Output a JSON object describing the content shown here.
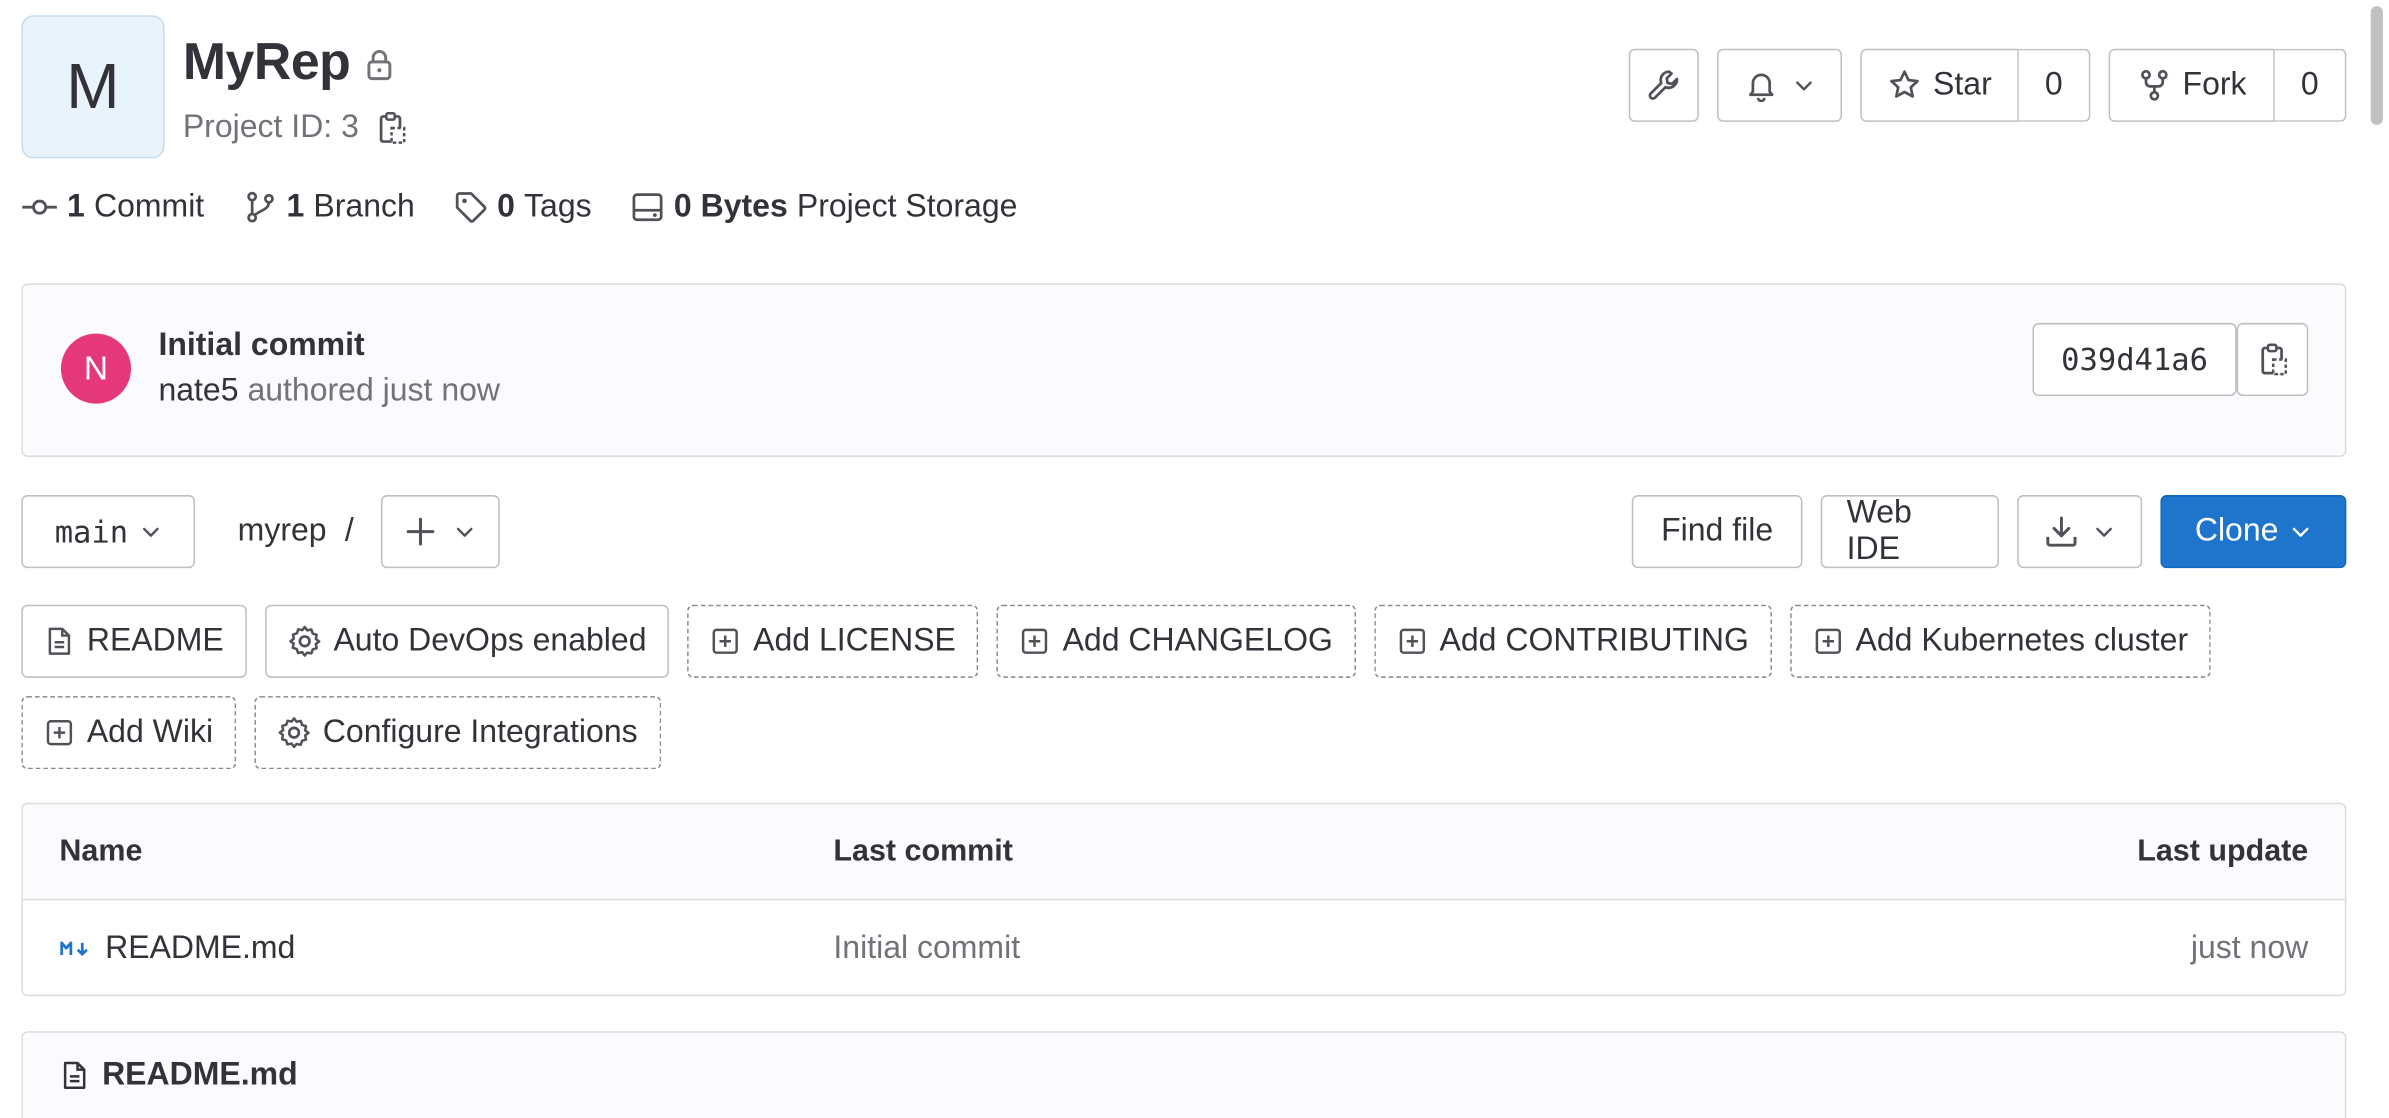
{
  "project": {
    "avatar_letter": "M",
    "name": "MyRep",
    "id_label": "Project ID: 3"
  },
  "header_actions": {
    "star_label": "Star",
    "star_count": "0",
    "fork_label": "Fork",
    "fork_count": "0"
  },
  "stats": {
    "commits_count": "1",
    "commits_label": "Commit",
    "branches_count": "1",
    "branches_label": "Branch",
    "tags_count": "0",
    "tags_label": "Tags",
    "storage_value": "0 Bytes",
    "storage_label": "Project Storage"
  },
  "last_commit": {
    "avatar_letter": "N",
    "title": "Initial commit",
    "author": "nate5",
    "meta": "authored just now",
    "sha": "039d41a6"
  },
  "repo_nav": {
    "branch": "main",
    "path": "myrep",
    "separator": "/",
    "find_file": "Find file",
    "web_ide": "Web IDE",
    "clone": "Clone"
  },
  "quick_buttons": [
    "README",
    "Auto DevOps enabled",
    "Add LICENSE",
    "Add CHANGELOG",
    "Add CONTRIBUTING",
    "Add Kubernetes cluster",
    "Add Wiki",
    "Configure Integrations"
  ],
  "file_table": {
    "headers": [
      "Name",
      "Last commit",
      "Last update"
    ],
    "rows": [
      {
        "name": "README.md",
        "last_commit": "Initial commit",
        "last_update": "just now"
      }
    ]
  },
  "readme": {
    "title": "README.md"
  },
  "colors": {
    "primary": "#1f75cb",
    "commit_avatar": "#e5387b",
    "project_avatar_bg": "#e9f3fc",
    "markdown_icon": "#1f75cb"
  }
}
